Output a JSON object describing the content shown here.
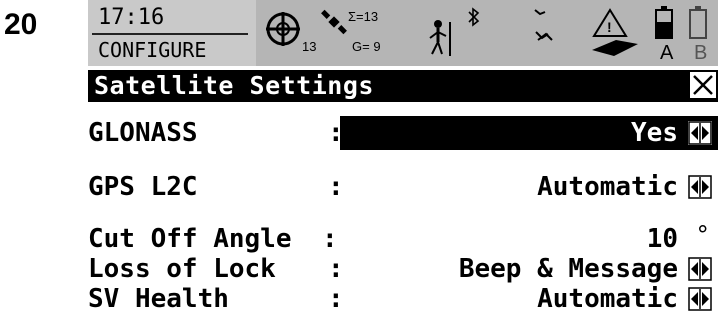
{
  "figure_number": "20",
  "status": {
    "time": "17:16",
    "mode": "CONFIGURE",
    "sat_count": "13",
    "sum_label": "Σ=13",
    "glonass_label": "G= 9",
    "battery_a": "A",
    "battery_b": "B"
  },
  "title": "Satellite Settings",
  "rows": [
    {
      "label": "GLONASS",
      "colon": ":",
      "value": "Yes"
    },
    {
      "label": "GPS L2C",
      "colon": ":",
      "value": "Automatic"
    },
    {
      "label": "Cut Off Angle",
      "colon": ":",
      "value": "10",
      "unit": "°"
    },
    {
      "label": "Loss of Lock",
      "colon": ":",
      "value": "Beep & Message"
    },
    {
      "label": "SV Health",
      "colon": ":",
      "value": "Automatic"
    }
  ],
  "icons": {
    "position": "crosshair-position-icon",
    "satellite": "satellite-icon",
    "rover": "rover-person-icon",
    "bluetooth": "bluetooth-icon",
    "radio": "radio-link-icon",
    "warning": "warning-icon",
    "memory": "memory-card-icon",
    "battery": "battery-icon",
    "close": "close-icon",
    "arrows": "left-right-arrows-icon"
  }
}
